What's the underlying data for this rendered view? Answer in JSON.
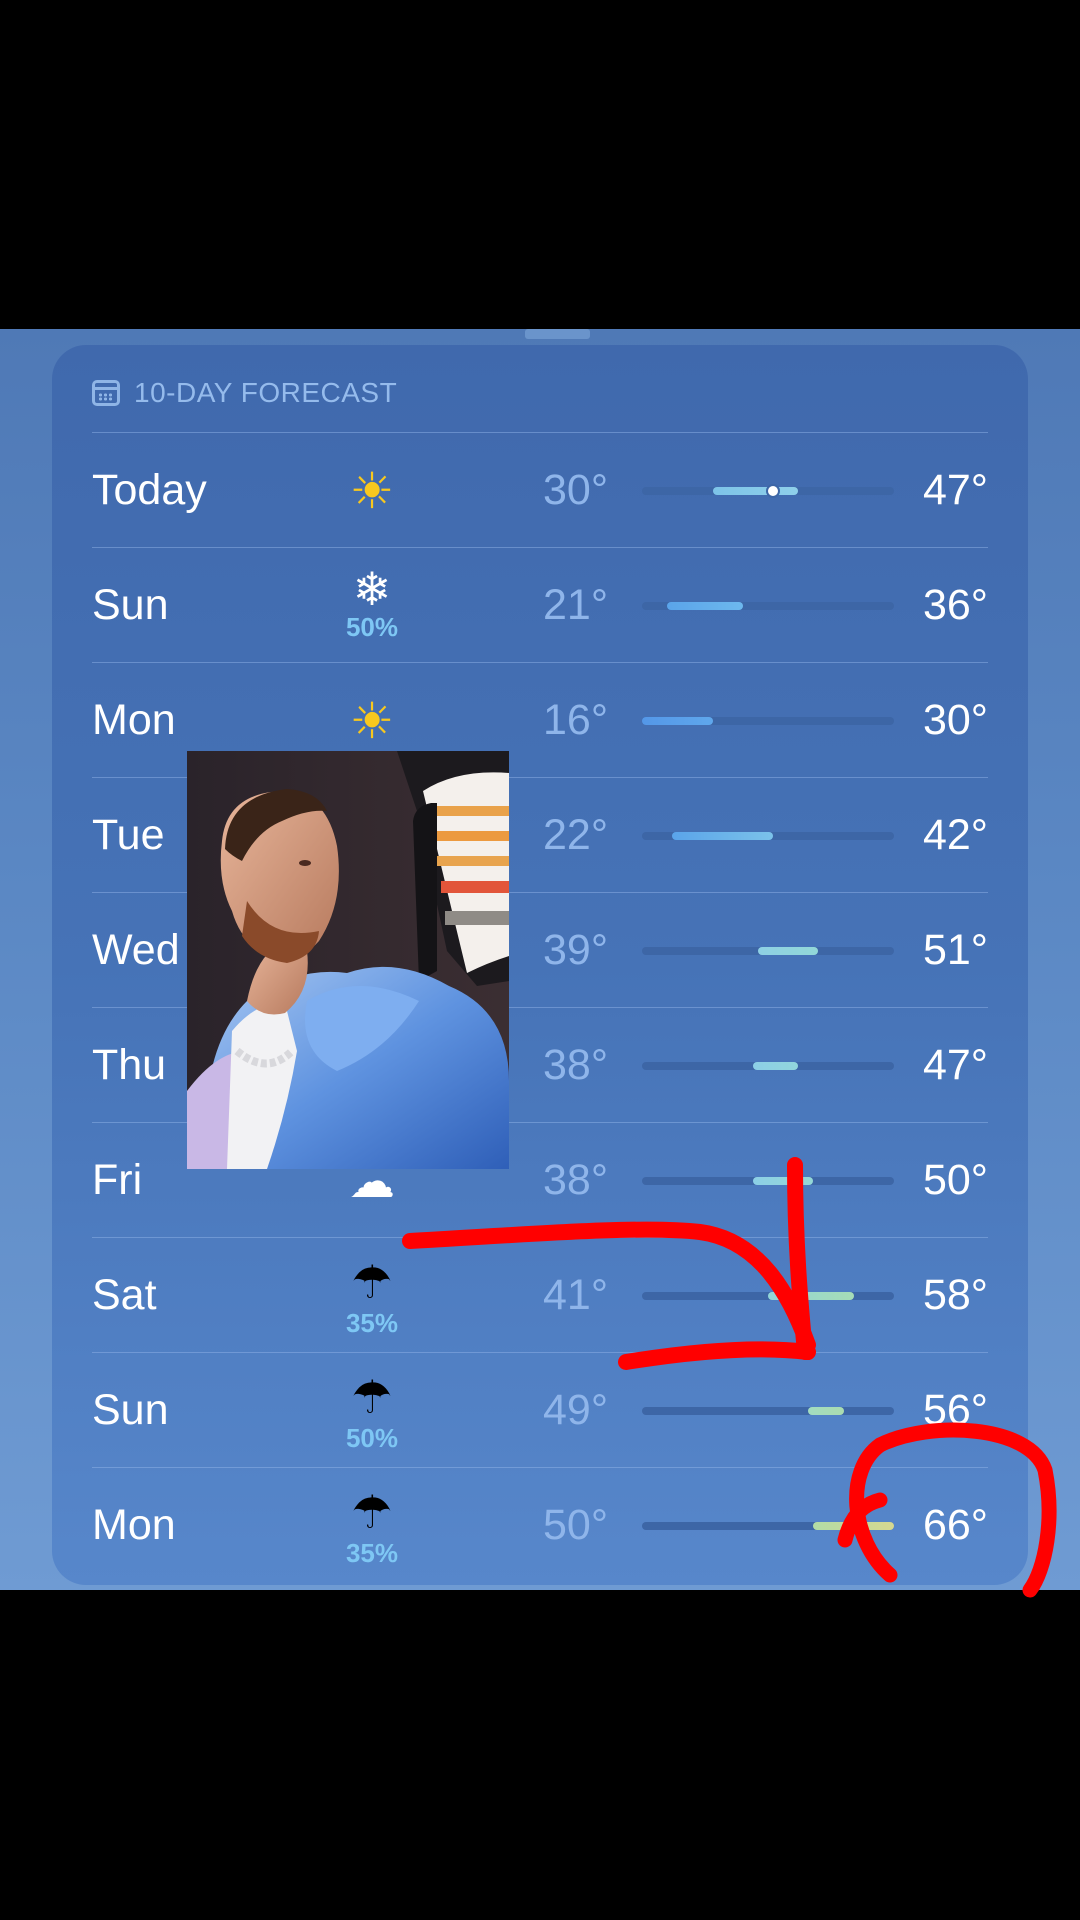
{
  "forecast": {
    "header_title": "10-DAY FORECAST",
    "header_icon": "calendar-icon",
    "scale": {
      "min": 16,
      "max": 66
    },
    "colors": {
      "snow_pct": "#7ec7f4",
      "low_temp": "#8fb5ea",
      "track": "#3d66a6",
      "annotation": "#ff0000"
    },
    "days": [
      {
        "day": "Today",
        "icon": "sun-icon",
        "glyph": "☀",
        "kind": "sun",
        "precip": "",
        "low": 30,
        "high": 47,
        "low_label": "30°",
        "high_label": "47°",
        "bar_from": "#7dc3e8",
        "bar_to": "#8fd0ea",
        "current": 42
      },
      {
        "day": "Sun",
        "icon": "snowflake-icon",
        "glyph": "❄",
        "kind": "snow",
        "precip": "50%",
        "low": 21,
        "high": 36,
        "low_label": "21°",
        "high_label": "36°",
        "bar_from": "#5aa4ea",
        "bar_to": "#6db8ee"
      },
      {
        "day": "Mon",
        "icon": "sun-icon",
        "glyph": "☀",
        "kind": "sun",
        "precip": "",
        "low": 16,
        "high": 30,
        "low_label": "16°",
        "high_label": "30°",
        "bar_from": "#5497e8",
        "bar_to": "#5fa7ec"
      },
      {
        "day": "Tue",
        "icon": "sun-icon",
        "glyph": "☀",
        "kind": "sun",
        "precip": "",
        "low": 22,
        "high": 42,
        "low_label": "22°",
        "high_label": "42°",
        "bar_from": "#5aa4ea",
        "bar_to": "#7bc2ea"
      },
      {
        "day": "Wed",
        "icon": "cloud-icon",
        "glyph": "☁",
        "kind": "cloud",
        "precip": "",
        "low": 39,
        "high": 51,
        "low_label": "39°",
        "high_label": "51°",
        "bar_from": "#8ed0e4",
        "bar_to": "#92d8d8"
      },
      {
        "day": "Thu",
        "icon": "cloud-icon",
        "glyph": "☁",
        "kind": "cloud",
        "precip": "",
        "low": 38,
        "high": 47,
        "low_label": "38°",
        "high_label": "47°",
        "bar_from": "#8ccfe6",
        "bar_to": "#92d6dc"
      },
      {
        "day": "Fri",
        "icon": "cloud-icon",
        "glyph": "☁",
        "kind": "cloud",
        "precip": "",
        "low": 38,
        "high": 50,
        "low_label": "38°",
        "high_label": "50°",
        "bar_from": "#8ccfe6",
        "bar_to": "#94d8d6"
      },
      {
        "day": "Sat",
        "icon": "cloud-rain-icon",
        "glyph": "☂",
        "kind": "rain",
        "precip": "35%",
        "low": 41,
        "high": 58,
        "low_label": "41°",
        "high_label": "58°",
        "bar_from": "#92d6d8",
        "bar_to": "#a6dcb6"
      },
      {
        "day": "Sun",
        "icon": "cloud-rain-icon",
        "glyph": "☂",
        "kind": "rain",
        "precip": "50%",
        "low": 49,
        "high": 56,
        "low_label": "49°",
        "high_label": "56°",
        "bar_from": "#a2dcc0",
        "bar_to": "#aadcb0"
      },
      {
        "day": "Mon",
        "icon": "cloud-rain-icon",
        "glyph": "☂",
        "kind": "rain",
        "precip": "35%",
        "low": 50,
        "high": 66,
        "low_label": "50°",
        "high_label": "66°",
        "bar_from": "#b2dca6",
        "bar_to": "#d6d890"
      }
    ]
  }
}
